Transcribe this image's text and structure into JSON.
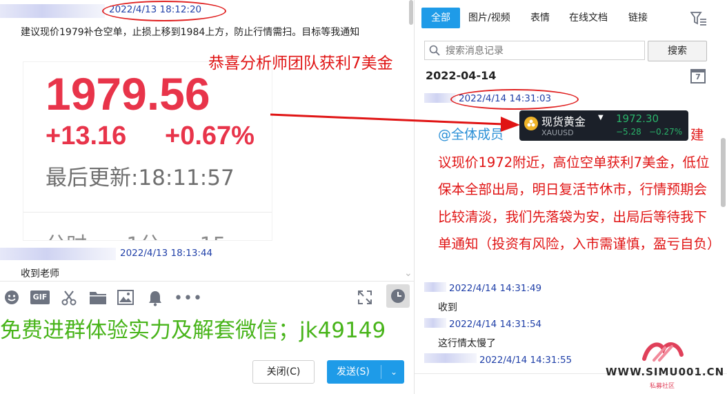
{
  "left_chat": {
    "msg1": {
      "timestamp": "2022/4/13 18:12:20",
      "text": "建议现价1979补仓空单，止损上移到1984上方，防止行情需扫。目标等我通知"
    },
    "quote_card": {
      "price": "1979.56",
      "change": "+13.16",
      "change_pct": "+0.67%",
      "updated": "最后更新:18:11:57",
      "tabs_partial": "分时      1分      15"
    },
    "msg2": {
      "timestamp": "2022/4/13 18:13:44",
      "text": "收到老师"
    }
  },
  "overlay_text": {
    "profit_banner": "恭喜分析师团队获利7美金",
    "promo": "免费进群体验实力及解套微信；jk49149"
  },
  "toolbar": {
    "icons": [
      "emoji-icon",
      "gif-icon",
      "scissors-icon",
      "folder-icon",
      "image-icon",
      "bell-icon",
      "more-icon",
      "expand-icon",
      "history-clock-icon"
    ],
    "gif_label": "GIF"
  },
  "buttons": {
    "close": "关闭(C)",
    "send": "发送(S)"
  },
  "history_panel": {
    "tabs": [
      "全部",
      "图片/视频",
      "表情",
      "在线文档",
      "链接"
    ],
    "active_tab": 0,
    "search_placeholder": "搜索消息记录",
    "search_button": "搜索",
    "date": "2022-04-14",
    "calendar_day": "7",
    "messages": [
      {
        "timestamp": "2022/4/14 14:31:03",
        "mention": "@全体成员",
        "text": "建议现价1972附近，高位空单获利7美金，低位保本全部出局，明日复活节休市，行情预期会比较清淡，我们先落袋为安，出局后等待我下单通知（投资有风险，入市需谨慎，盈亏自负）"
      },
      {
        "timestamp": "2022/4/14 14:31:49",
        "text": "收到"
      },
      {
        "timestamp": "2022/4/14 14:31:54",
        "text": "这行情太慢了"
      },
      {
        "timestamp": "2022/4/14 14:31:55",
        "text": ""
      }
    ]
  },
  "ticker": {
    "name": "现货黄金",
    "symbol": "XAUUSD",
    "price": "1972.30",
    "change": "−5.28",
    "change_pct": "−0.27%"
  },
  "watermark": {
    "site": "WWW.SIMU001.CN",
    "sub": "私募社区"
  },
  "colors": {
    "accent_blue": "#1e9be8",
    "price_red": "#e8344a",
    "promo_green": "#48b41a",
    "annotation_red": "#e01414",
    "ticker_bg": "#1b2029",
    "ticker_green": "#2ab36a"
  }
}
